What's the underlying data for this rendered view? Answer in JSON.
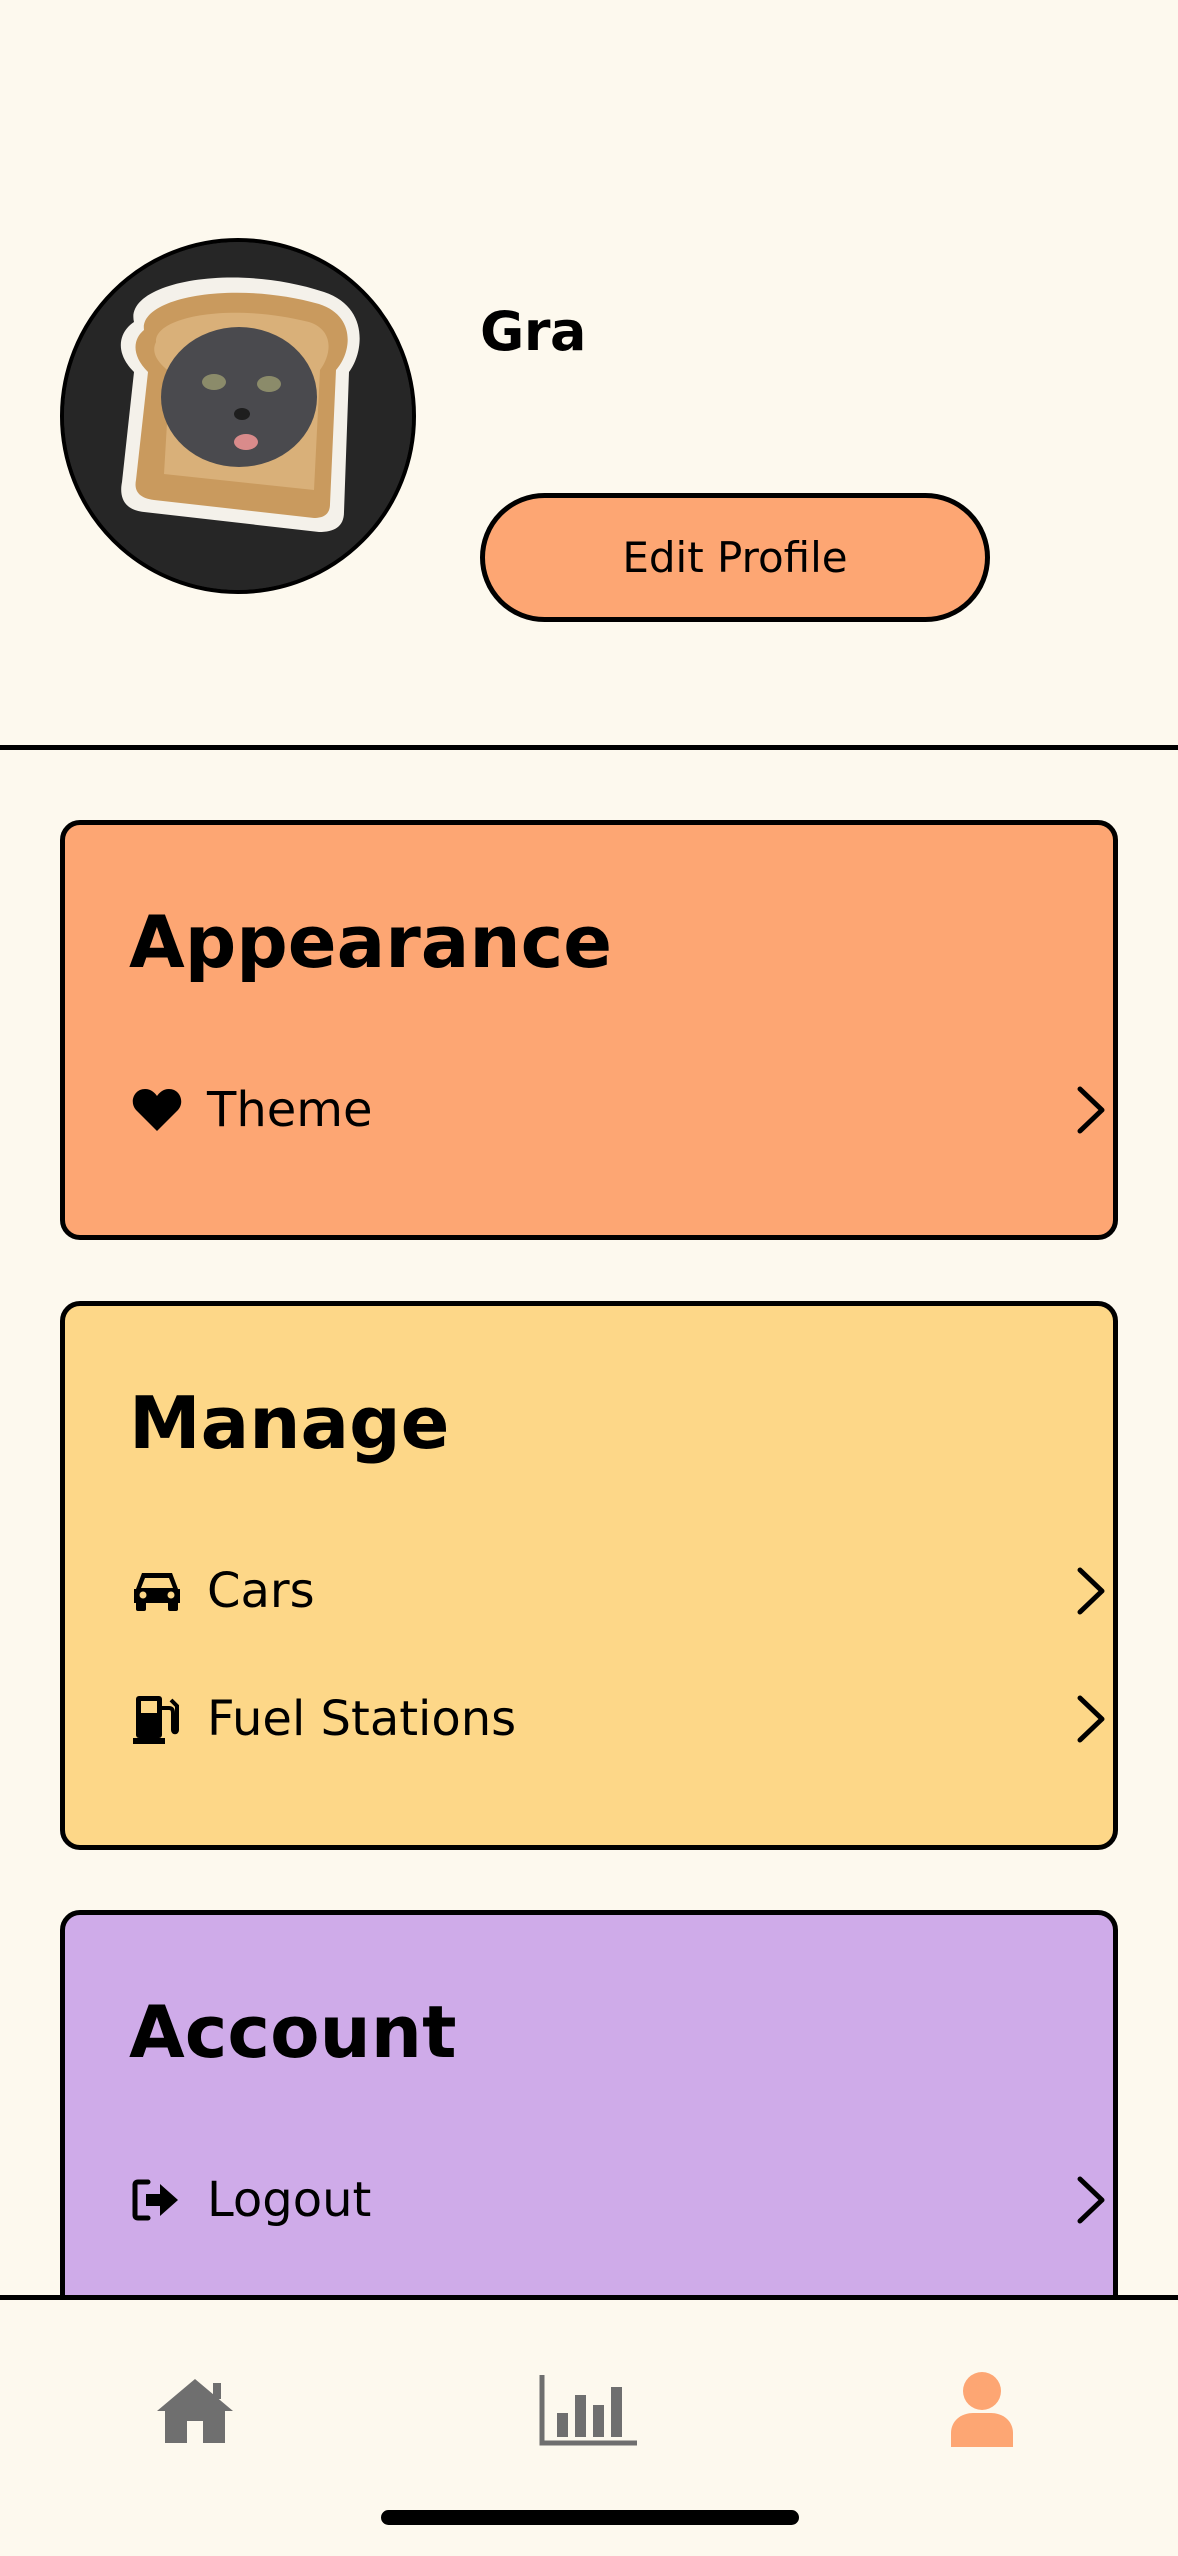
{
  "profile": {
    "username": "Gra",
    "edit_label": "Edit Profile",
    "avatar_icon": "cat-toast-photo"
  },
  "sections": {
    "appearance": {
      "title": "Appearance",
      "color": "#fda673",
      "items": [
        {
          "label": "Theme",
          "icon": "heart-icon"
        }
      ]
    },
    "manage": {
      "title": "Manage",
      "color": "#fdd788",
      "items": [
        {
          "label": "Cars",
          "icon": "car-icon"
        },
        {
          "label": "Fuel Stations",
          "icon": "gas-pump-icon"
        }
      ]
    },
    "account": {
      "title": "Account",
      "color": "#cfabe9",
      "items": [
        {
          "label": "Logout",
          "icon": "logout-icon"
        }
      ]
    }
  },
  "tabbar": {
    "tabs": [
      {
        "name": "home",
        "icon": "home-icon",
        "active": false
      },
      {
        "name": "stats",
        "icon": "bar-chart-icon",
        "active": false
      },
      {
        "name": "profile",
        "icon": "user-icon",
        "active": true
      }
    ],
    "active_color": "#fda673",
    "inactive_color": "#6f6f6f"
  }
}
